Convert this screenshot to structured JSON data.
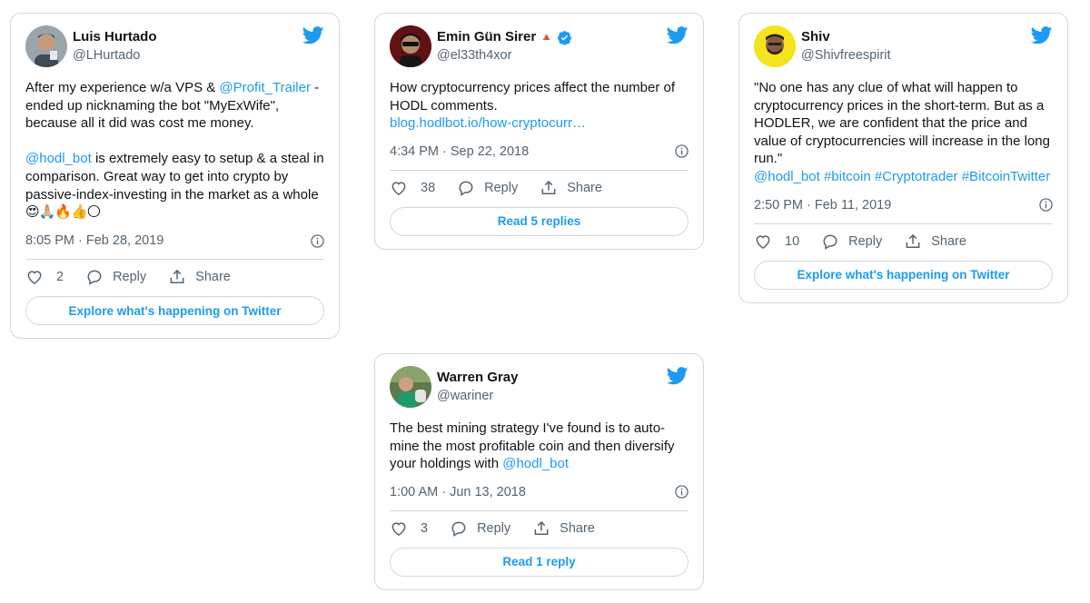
{
  "brand_color": "#1d9bf0",
  "icons": {
    "bird": "twitter-bird-icon",
    "info": "info-icon",
    "like": "heart-icon",
    "reply": "reply-bubble-icon",
    "share": "share-icon",
    "verified": "verified-badge-icon"
  },
  "tweets": [
    {
      "name": "Luis Hurtado",
      "handle": "@LHurtado",
      "text": [
        {
          "t": "After my experience w/a VPS & "
        },
        {
          "t": "@Profit_Trailer",
          "link": true
        },
        {
          "t": " - ended up nicknaming the bot \"MyExWife\", because all it did was cost me money.\n\n"
        },
        {
          "t": "@hodl_bot",
          "link": true
        },
        {
          "t": " is extremely easy to setup & a steal in comparison. Great way to get into crypto by passive-index-investing in the market as a whole"
        }
      ],
      "emojis": "😍🙏🏼🔥👍🌕",
      "timestamp": "8:05 PM · Feb 28, 2019",
      "likes": "2",
      "reply_label": "Reply",
      "share_label": "Share",
      "cta": "Explore what's happening on Twitter"
    },
    {
      "name": "Emin Gün Sirer",
      "name_suffix": "🔺",
      "verified": true,
      "handle": "@el33th4xor",
      "text": [
        {
          "t": "How cryptocurrency prices affect the number of HODL comments.\n"
        },
        {
          "t": "blog.hodlbot.io/how-cryptocurr…",
          "link": true
        }
      ],
      "timestamp": "4:34 PM · Sep 22, 2018",
      "likes": "38",
      "reply_label": "Reply",
      "share_label": "Share",
      "cta": "Read 5 replies"
    },
    {
      "name": "Shiv",
      "handle": "@Shivfreespirit",
      "text": [
        {
          "t": "\"No one has any clue of what will happen to cryptocurrency prices in the short-term. But as a HODLER, we are confident that the price and value of cryptocurrencies will increase in the long run.\"\n"
        },
        {
          "t": "@hodl_bot",
          "link": true
        },
        {
          "t": " "
        },
        {
          "t": "#bitcoin",
          "link": true
        },
        {
          "t": " "
        },
        {
          "t": "#Cryptotrader",
          "link": true
        },
        {
          "t": " "
        },
        {
          "t": "#BitcoinTwitter",
          "link": true
        }
      ],
      "timestamp": "2:50 PM · Feb 11, 2019",
      "likes": "10",
      "reply_label": "Reply",
      "share_label": "Share",
      "cta": "Explore what's happening on Twitter"
    },
    {
      "name": "Warren Gray",
      "handle": "@wariner",
      "text": [
        {
          "t": "The best mining strategy I've found is to auto-mine the most profitable coin and then diversify your holdings with "
        },
        {
          "t": "@hodl_bot",
          "link": true
        }
      ],
      "timestamp": "1:00 AM · Jun 13, 2018",
      "likes": "3",
      "reply_label": "Reply",
      "share_label": "Share",
      "cta": "Read 1 reply"
    }
  ]
}
